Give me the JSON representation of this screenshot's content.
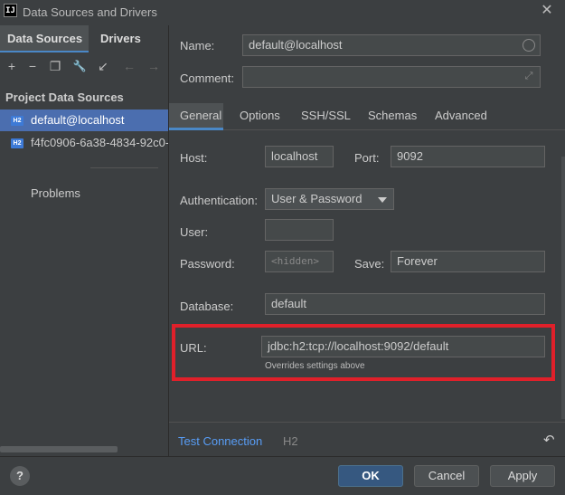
{
  "window": {
    "title": "Data Sources and Drivers",
    "app_icon_text": "IJ"
  },
  "left": {
    "tabs": [
      {
        "label": "Data Sources"
      },
      {
        "label": "Drivers"
      }
    ],
    "toolbar": {
      "add": "+",
      "remove": "−",
      "copy": "❐",
      "wrench": "🔧",
      "import": "↙",
      "back": "←",
      "forward": "→"
    },
    "section_title": "Project Data Sources",
    "items": [
      {
        "label": "default@localhost",
        "badge": "H2",
        "selected": true
      },
      {
        "label": "f4fc0906-6a38-4834-92c0-",
        "badge": "H2",
        "selected": false
      }
    ],
    "problems_label": "Problems"
  },
  "form": {
    "name_label": "Name:",
    "name_value": "default@localhost",
    "comment_label": "Comment:",
    "comment_value": "",
    "tabs": [
      {
        "label": "General",
        "active": true
      },
      {
        "label": "Options"
      },
      {
        "label": "SSH/SSL"
      },
      {
        "label": "Schemas"
      },
      {
        "label": "Advanced"
      }
    ],
    "host_label": "Host:",
    "host_value": "localhost",
    "port_label": "Port:",
    "port_value": "9092",
    "auth_label": "Authentication:",
    "auth_value": "User & Password",
    "user_label": "User:",
    "user_value": "",
    "password_label": "Password:",
    "password_placeholder": "<hidden>",
    "save_label": "Save:",
    "save_value": "Forever",
    "database_label": "Database:",
    "database_value": "default",
    "url_label": "URL:",
    "url_value": "jdbc:h2:tcp://localhost:9092/default",
    "url_note": "Overrides settings above",
    "test_connection": "Test Connection",
    "driver_name": "H2"
  },
  "footer": {
    "help": "?",
    "ok": "OK",
    "cancel": "Cancel",
    "apply": "Apply"
  },
  "colors": {
    "accent": "#4a88c7",
    "selection": "#4b6eaf",
    "highlight": "#e0202a",
    "link": "#589df6"
  }
}
